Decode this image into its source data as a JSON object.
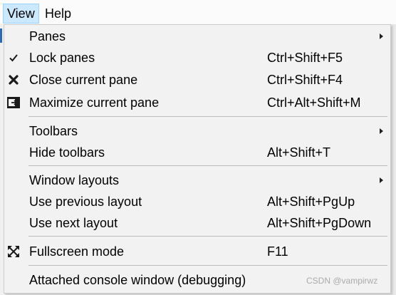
{
  "menubar": {
    "view_label": "View",
    "help_label": "Help"
  },
  "menu": {
    "panes": {
      "label": "Panes"
    },
    "lock_panes": {
      "label": "Lock panes",
      "shortcut": "Ctrl+Shift+F5",
      "icon": "check-icon"
    },
    "close_current_pane": {
      "label": "Close current pane",
      "shortcut": "Ctrl+Shift+F4",
      "icon": "close-icon"
    },
    "maximize_current_pane": {
      "label": "Maximize current pane",
      "shortcut": "Ctrl+Alt+Shift+M",
      "icon": "maximize-pane-icon"
    },
    "toolbars": {
      "label": "Toolbars"
    },
    "hide_toolbars": {
      "label": "Hide toolbars",
      "shortcut": "Alt+Shift+T"
    },
    "window_layouts": {
      "label": "Window layouts"
    },
    "use_previous_layout": {
      "label": "Use previous layout",
      "shortcut": "Alt+Shift+PgUp"
    },
    "use_next_layout": {
      "label": "Use next layout",
      "shortcut": "Alt+Shift+PgDown"
    },
    "fullscreen_mode": {
      "label": "Fullscreen mode",
      "shortcut": "F11",
      "icon": "fullscreen-icon"
    },
    "attached_console": {
      "label": "Attached console window (debugging)"
    }
  },
  "watermark": "CSDN @vampirwz",
  "colors": {
    "menubar_open_bg": "#cce8ff",
    "menubar_open_border": "#99d1ff",
    "dropdown_bg": "#f2f2f2"
  }
}
